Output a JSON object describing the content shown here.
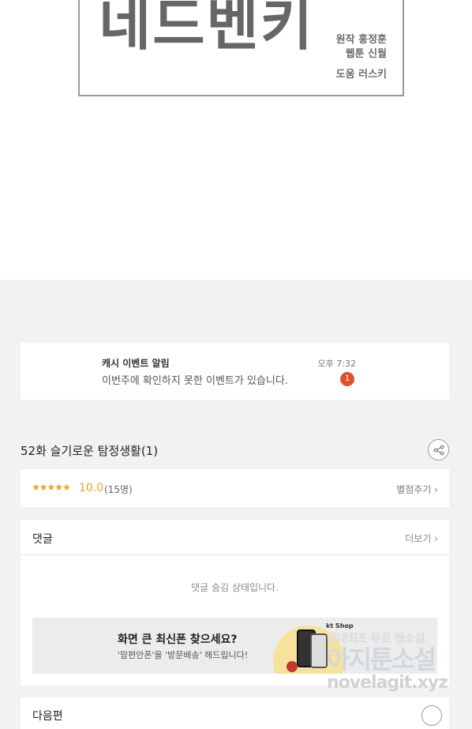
{
  "poster": {
    "title": "네드벤키",
    "credits": {
      "original": "원작 홍정훈",
      "webtoon": "웹툰   신월",
      "assist": "도움 러스키"
    }
  },
  "notice": {
    "title": "캐시 이벤트 알림",
    "message": "이번주에 확인하지 못한 이벤트가 있습니다.",
    "time": "오후 7:32",
    "badge": "1"
  },
  "episode": {
    "title": "52화 슬기로운 탐정생활(1)"
  },
  "rating": {
    "stars": "★★★★★",
    "score": "10.0",
    "count": "(15명)",
    "rate_label": "별점주기"
  },
  "comments": {
    "title": "댓글",
    "more_label": "더보기",
    "hidden_notice": "댓글 숨김 상태입니다."
  },
  "ad": {
    "title": "화면 큰 최신폰 찾으세요?",
    "subtitle": "'맘편안폰'을 '방문배송' 해드립니다!",
    "brand": "kt Shop"
  },
  "next": {
    "title": "다음편"
  },
  "watermark": {
    "line1": "국내최초 무료 웹소설",
    "line2": "아지툰소설",
    "line3": "novelagit.xyz"
  },
  "colors": {
    "accent_star": "#f0a020",
    "badge": "#e0502f"
  }
}
